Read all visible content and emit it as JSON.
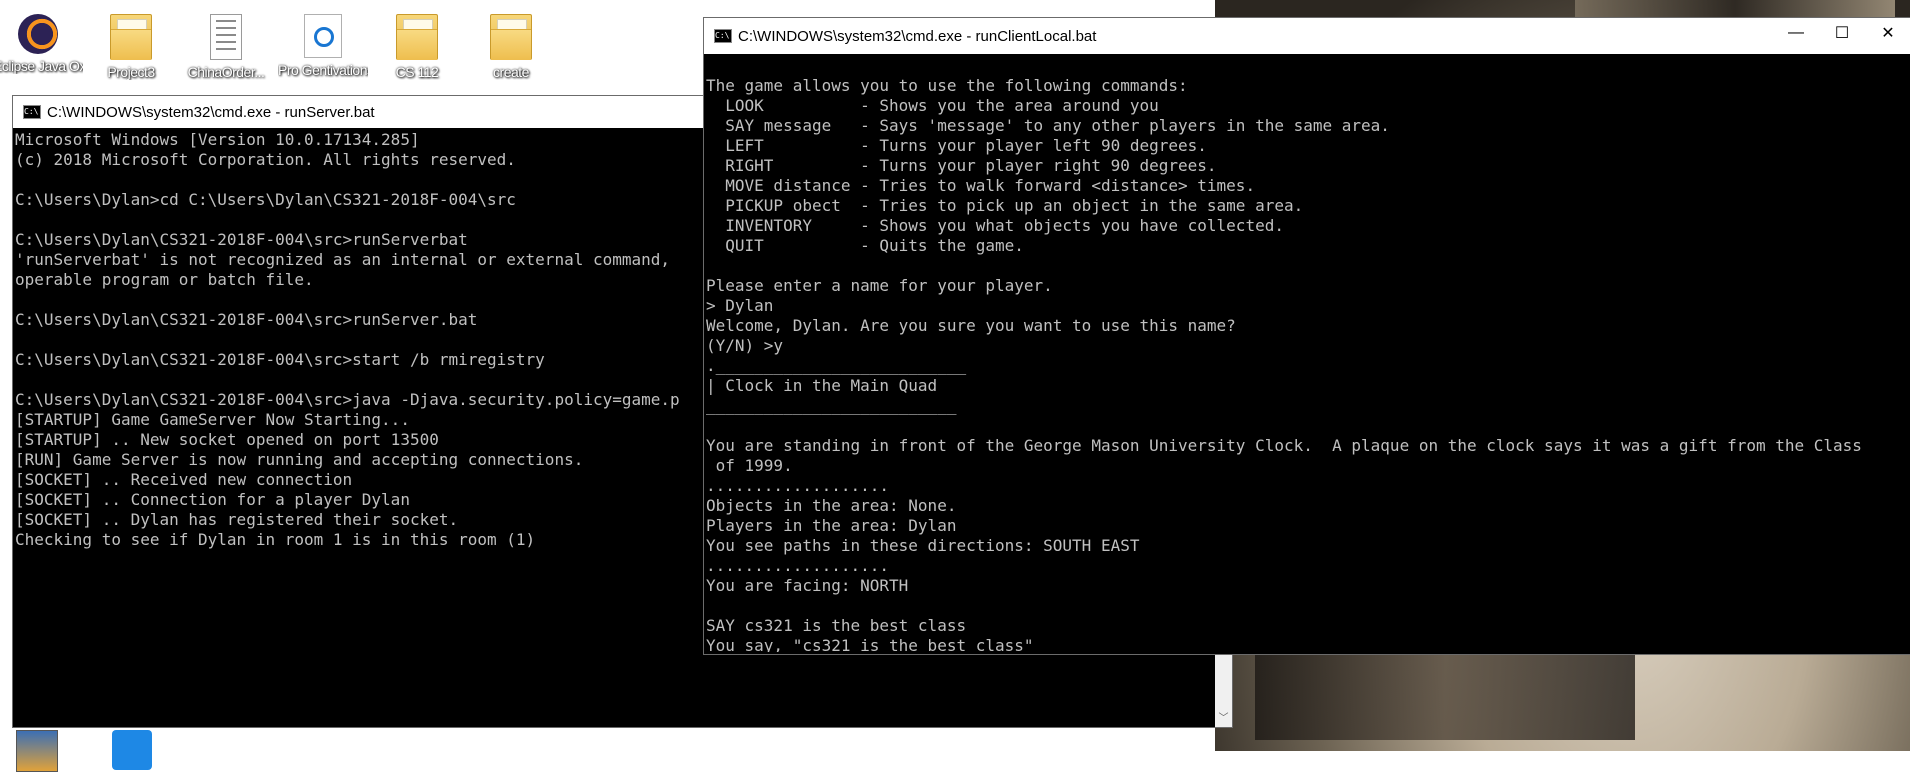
{
  "desktop": {
    "icons": [
      {
        "label": "Eclipse Java Oxygen",
        "icon": "eclipse-icon"
      },
      {
        "label": "Project3",
        "icon": "folder-icon"
      },
      {
        "label": "ChinaOrder...",
        "icon": "document-icon"
      },
      {
        "label": "Pro Gentivations",
        "icon": "pro-app-icon"
      },
      {
        "label": "CS 112",
        "icon": "folder-icon"
      },
      {
        "label": "create",
        "icon": "folder-icon"
      }
    ]
  },
  "server_window": {
    "title": "C:\\WINDOWS\\system32\\cmd.exe - runServer.bat",
    "lines": [
      "Microsoft Windows [Version 10.0.17134.285]",
      "(c) 2018 Microsoft Corporation. All rights reserved.",
      "",
      "C:\\Users\\Dylan>cd C:\\Users\\Dylan\\CS321-2018F-004\\src",
      "",
      "C:\\Users\\Dylan\\CS321-2018F-004\\src>runServerbat",
      "'runServerbat' is not recognized as an internal or external command,",
      "operable program or batch file.",
      "",
      "C:\\Users\\Dylan\\CS321-2018F-004\\src>runServer.bat",
      "",
      "C:\\Users\\Dylan\\CS321-2018F-004\\src>start /b rmiregistry",
      "",
      "C:\\Users\\Dylan\\CS321-2018F-004\\src>java -Djava.security.policy=game.p",
      "[STARTUP] Game GameServer Now Starting...",
      "[STARTUP] .. New socket opened on port 13500",
      "[RUN] Game Server is now running and accepting connections.",
      "[SOCKET] .. Received new connection",
      "[SOCKET] .. Connection for a player Dylan",
      "[SOCKET] .. Dylan has registered their socket.",
      "Checking to see if Dylan in room 1 is in this room (1)"
    ]
  },
  "client_window": {
    "title": "C:\\WINDOWS\\system32\\cmd.exe - runClientLocal.bat",
    "controls": {
      "minimize": "—",
      "maximize": "☐",
      "close": "✕"
    },
    "lines": [
      "",
      "The game allows you to use the following commands:",
      "  LOOK          - Shows you the area around you",
      "  SAY message   - Says 'message' to any other players in the same area.",
      "  LEFT          - Turns your player left 90 degrees.",
      "  RIGHT         - Turns your player right 90 degrees.",
      "  MOVE distance - Tries to walk forward <distance> times.",
      "  PICKUP obect  - Tries to pick up an object in the same area.",
      "  INVENTORY     - Shows you what objects you have collected.",
      "  QUIT          - Quits the game.",
      "",
      "Please enter a name for your player.",
      "> Dylan",
      "Welcome, Dylan. Are you sure you want to use this name?",
      "(Y/N) >y",
      ".__________________________",
      "| Clock in the Main Quad",
      "__________________________",
      "",
      "You are standing in front of the George Mason University Clock.  A plaque on the clock says it was a gift from the Class",
      " of 1999.",
      "...................",
      "Objects in the area: None.",
      "Players in the area: Dylan",
      "You see paths in these directions: SOUTH EAST",
      "...................",
      "You are facing: NORTH",
      "",
      "SAY cs321 is the best class",
      "You say, \"cs321 is the best class\""
    ]
  },
  "scroll_down_arrow": "﹀"
}
